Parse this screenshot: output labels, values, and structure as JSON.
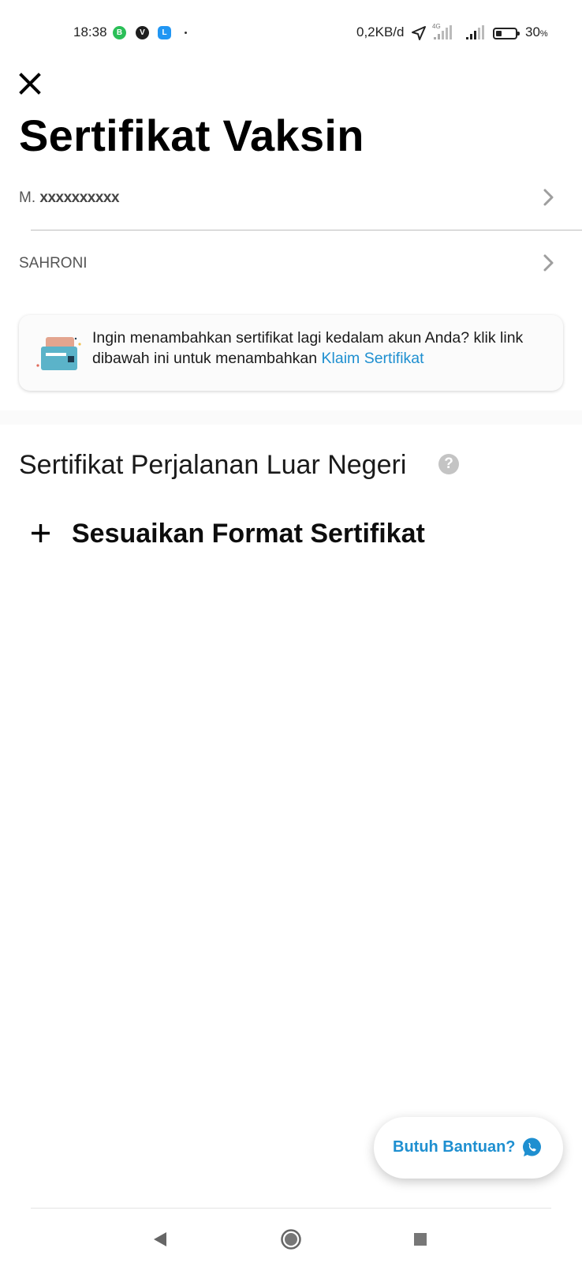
{
  "status_bar": {
    "time": "18:38",
    "notification_icons": [
      "whatsapp-business-icon",
      "v-app-icon",
      "l-app-icon"
    ],
    "network_speed": "0,2KB/d",
    "network_type": "4G",
    "battery_level": 30,
    "battery_percent": "30",
    "battery_unit": "%"
  },
  "header": {
    "title": "Sertifikat Vaksin"
  },
  "certificates": [
    {
      "prefix": "M.",
      "masked": "xxxxxxxxxx"
    },
    {
      "prefix": "SAHRONI",
      "masked": ""
    }
  ],
  "info_card": {
    "text": "Ingin menambahkan sertifikat lagi kedalam akun Anda? klik link dibawah ini untuk menambahkan ",
    "link_label": "Klaim Sertifikat"
  },
  "travel_section": {
    "title": "Sertifikat Perjalanan Luar Negeri",
    "help_glyph": "?",
    "customize_label": "Sesuaikan Format Sertifikat"
  },
  "help_button": {
    "label": "Butuh Bantuan?"
  },
  "colors": {
    "link_blue": "#1e8fd0",
    "text": "#111111",
    "muted": "#555555"
  }
}
